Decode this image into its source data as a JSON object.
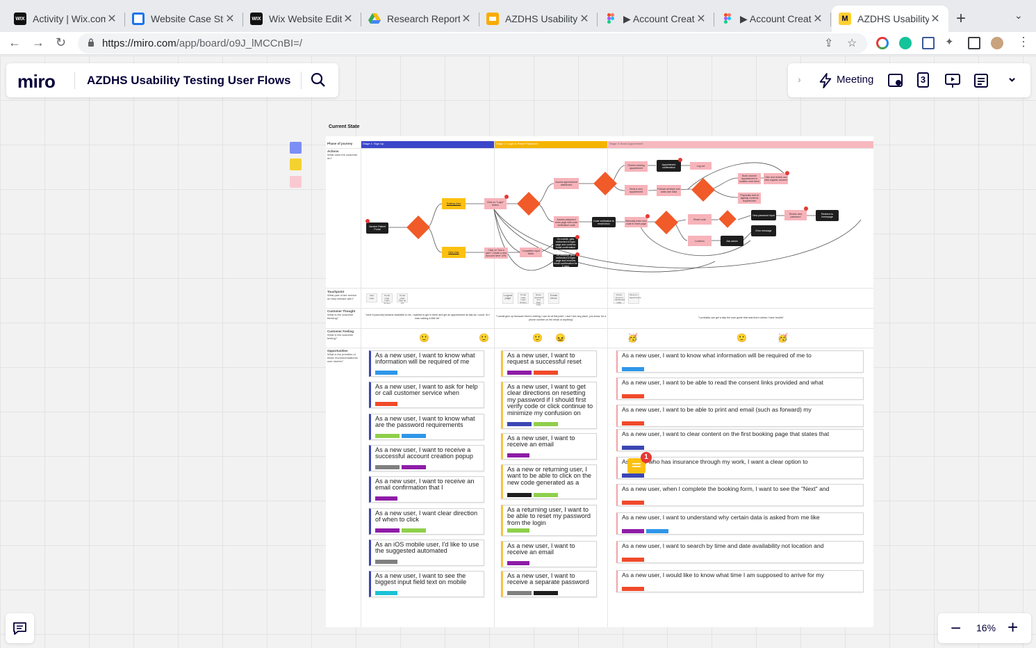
{
  "browser": {
    "tabs": [
      {
        "title": "Activity | Wix.com",
        "favicon": "wix-logo"
      },
      {
        "title": "Website Case Stu",
        "favicon": "globe-logo"
      },
      {
        "title": "Wix Website Edito",
        "favicon": "wix-logo"
      },
      {
        "title": "Research Report",
        "favicon": "drive-logo"
      },
      {
        "title": "AZDHS Usability",
        "favicon": "slides-logo"
      },
      {
        "title": "▶ Account Creati",
        "favicon": "figma-logo"
      },
      {
        "title": "▶ Account Creati",
        "favicon": "figma-logo"
      },
      {
        "title": "AZDHS Usability",
        "favicon": "miro-logo"
      }
    ],
    "url": "https://miro.com/app/board/o9J_lMCCnBI=/",
    "url_host": "https://miro.com",
    "url_path": "/app/board/o9J_lMCCnBI=/"
  },
  "miro": {
    "logo": "miro",
    "board_title": "AZDHS Usability Testing User Flows",
    "meeting_label": "Meeting",
    "timer_value": "3",
    "zoom_level": "16%"
  },
  "board": {
    "frame_title": "Current State",
    "rows": [
      {
        "title": "Phase of journey",
        "desc": ""
      },
      {
        "title": "Actions",
        "desc": "What does the customer do?"
      },
      {
        "title": "Touchpoint",
        "desc": "What part of the service do they interact with?"
      },
      {
        "title": "Customer Thought",
        "desc": "What is the customer thinking?"
      },
      {
        "title": "Customer Feeling",
        "desc": "What is the customer feeling?"
      },
      {
        "title": "Opportunities",
        "desc": "What is the priorities of these recommendations/ user stories?"
      }
    ],
    "stages": [
      {
        "label": "Stage 1: Sign Up",
        "color": "#3b46c9"
      },
      {
        "label": "Stage 2: Login & Reset Password",
        "color": "#f5b400"
      },
      {
        "label": "Stage 3: Book Appointment",
        "color": "#f7b8bf"
      }
    ],
    "flow_nodes": {
      "n1": "Vaccine Patient Portal",
      "n2": "Existing User",
      "n3": "New User",
      "n4": "Click on \"Login\" button",
      "n5": "Click on \"Not a user? Create a new Account here\" URL",
      "n6": "Completes Input fields",
      "n7": "Access appointment dashboard",
      "n8": "Access password reset page with code verification code",
      "n9": "Code verification to email inbox",
      "n10": "Review existing appointment",
      "n11": "Book a new appointment",
      "n12": "Appointment confirmation",
      "n13": "Log out",
      "n14": "Follows all steps and adds user data",
      "n15": "Book vaccine appointment to location near them",
      "n16": "Physically visit at digitally confirms required info",
      "n17": "Click and review can view register consent",
      "n18": "Manually enter new code in reset page",
      "n19": "Reset code",
      "n20": "Confirms",
      "n21": "Ask admin",
      "n22": "New password input",
      "n23": "Error message",
      "n24": "Resets new password",
      "n25": "Redirect to homepage",
      "n26": "On mobile, gets redirected to login page and confirms email confirmation",
      "n27": "On desktop, gets redirected to login page and receives email confirmation for 2 days"
    },
    "touchpoints": {
      "stage1": [
        "Start page",
        "Portal page Login Screen",
        "Portal page Sign up UX"
      ],
      "stage2": [
        "Logout page",
        "Portal page Login Screen",
        "Reset password and login page",
        "Email inbox"
      ],
      "stage3": [
        "Portal: Account dashboard page",
        "Book an appointment"
      ]
    },
    "thoughts": {
      "stage1": "\"once it [vaccine] became available to me, I wanted to get in there and get an appointment as fast as I could. So I was rushing a little bit.\"",
      "stage2": "\"I would give up because there's nothing I can do at this point. I don't see any place, you know, for a phone number on the email or anything\"",
      "stage3": "\"I probably can get a skip the user guide that was there unless I have trouble\""
    },
    "feelings": [
      "🙂",
      "🙂",
      "🙂",
      "😖",
      "🥳",
      "🙂",
      "🥳"
    ],
    "stories": {
      "stage1": [
        {
          "text": "As a new user, I want to know what information will be required of me",
          "tags": [
            "#2f96e8"
          ]
        },
        {
          "text": "As a new user, I want to ask for help or call customer service when",
          "tags": [
            "#f04a2a"
          ]
        },
        {
          "text": "As a new user, I want to know what are the password requirements",
          "tags": [
            "#8fcf4b",
            "#2f96e8"
          ]
        },
        {
          "text": "As a new user, I want to receive a successful account creation popup",
          "tags": [
            "#808080",
            "#8e1ca7"
          ]
        },
        {
          "text": "As a new user, I want to receive an email confirmation that I",
          "tags": [
            "#8e1ca7"
          ]
        },
        {
          "text": "As a new user, I want clear direction of when to click",
          "tags": [
            "#8e1ca7",
            "#8fcf4b"
          ]
        },
        {
          "text": "As an iOS mobile user, I'd like to use the suggested automated",
          "tags": [
            "#808080"
          ]
        },
        {
          "text": "As a new user, I want to see the biggest input field text on mobile",
          "tags": [
            "#1cc1d6"
          ]
        }
      ],
      "stage2": [
        {
          "text": "As a new user, I want to request a successful reset",
          "tags": [
            "#8e1ca7",
            "#f04a2a"
          ]
        },
        {
          "text": "As a new user, I want to get clear directions on resetting my password if I should first verify code or click continue to minimize my confusion on",
          "tags": [
            "#3b46b5",
            "#8fcf4b"
          ]
        },
        {
          "text": "As a new user, I want to receive an email",
          "tags": [
            "#8e1ca7"
          ]
        },
        {
          "text": "As a new or returning user, I want to be able to click on the new code generated as a",
          "tags": [
            "#1e1e1e",
            "#8fcf4b"
          ]
        },
        {
          "text": "As a returning user, I want to be able to reset my password from the login",
          "tags": [
            "#8fcf4b"
          ]
        },
        {
          "text": "As a new user, I want to receive an email",
          "tags": [
            "#8e1ca7"
          ]
        },
        {
          "text": "As a new user, I want to receive a separate password",
          "tags": [
            "#808080",
            "#1e1e1e"
          ]
        }
      ],
      "stage3": [
        {
          "text": "As a new user, I want to know what information will be required of me to",
          "tags": [
            "#2f96e8"
          ]
        },
        {
          "text": "As a new user, I want to be able to read the consent links provided and what",
          "tags": [
            "#f04a2a"
          ]
        },
        {
          "text": "As a new user, I want to be able to print and email (such as forward) my",
          "tags": [
            "#f04a2a"
          ]
        },
        {
          "text": "As a new user, I want to clear content on the first booking page that states that",
          "tags": [
            "#3b46b5"
          ]
        },
        {
          "text": "As a user who has insurance through my work, I want a clear option to",
          "tags": [
            "#3b46b5"
          ]
        },
        {
          "text": "As a new user, when I complete the booking form, I want to see the \"Next\" and",
          "tags": [
            "#f04a2a"
          ]
        },
        {
          "text": "As a new user, I want to understand why certain data is asked from me like",
          "tags": [
            "#8e1ca7",
            "#2f96e8"
          ]
        },
        {
          "text": "As a new user, I want to search by time and date availability not location and",
          "tags": [
            "#f04a2a"
          ]
        },
        {
          "text": "As a new user, I would like to know what time I am supposed to arrive for my",
          "tags": [
            "#f04a2a"
          ]
        }
      ]
    },
    "comment_count": "1"
  }
}
